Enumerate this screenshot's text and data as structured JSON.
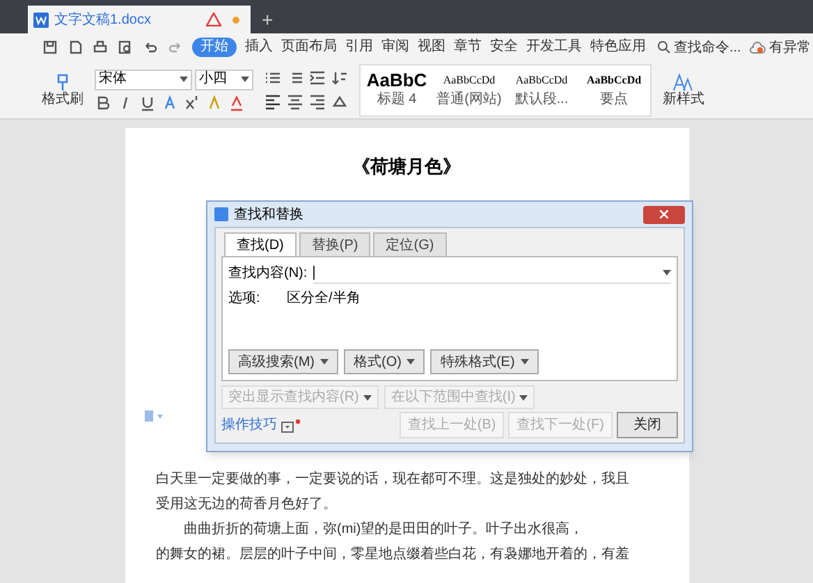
{
  "tabbar": {
    "documents": [
      {
        "title": "文字文稿1.docx",
        "selected": true,
        "warning": true,
        "unsaved": true
      }
    ],
    "new_tab": "+"
  },
  "menu": {
    "items": [
      {
        "label": "开始",
        "selected": true
      },
      {
        "label": "插入",
        "selected": false
      },
      {
        "label": "页面布局",
        "selected": false
      },
      {
        "label": "引用",
        "selected": false
      },
      {
        "label": "审阅",
        "selected": false
      },
      {
        "label": "视图",
        "selected": false
      },
      {
        "label": "章节",
        "selected": false
      },
      {
        "label": "安全",
        "selected": false
      },
      {
        "label": "开发工具",
        "selected": false
      },
      {
        "label": "特色应用",
        "selected": false
      }
    ],
    "search": "查找命令...",
    "status": "有异常"
  },
  "ribbon": {
    "format_painter": "格式刷",
    "font": "宋体",
    "size": "小四",
    "styles": [
      {
        "sample": "AaBbC",
        "label": "标题 4",
        "kind": "heading"
      },
      {
        "sample": "AaBbCcDd",
        "label": "普通(网站)",
        "kind": "normal"
      },
      {
        "sample": "AaBbCcDd",
        "label": "默认段...",
        "kind": "normal"
      },
      {
        "sample": "AaBbCcDd",
        "label": "要点",
        "kind": "bold"
      }
    ],
    "new_style": "新样式"
  },
  "document": {
    "title": "《荷塘月色》",
    "paragraphs_below": [
      "白天里一定要做的事，一定要说的话，现在都可不理。这是独处的妙处，我且",
      "受用这无边的荷香月色好了。",
      "　　曲曲折折的荷塘上面，弥(mi)望的是田田的叶子。叶子出水很高，",
      "的舞女的裙。层层的叶子中间，零星地点缀着些白花，有袅娜地开着的，有羞"
    ]
  },
  "dialog": {
    "title": "查找和替换",
    "tabs": [
      {
        "label": "查找(D)",
        "selected": true
      },
      {
        "label": "替换(P)",
        "selected": false
      },
      {
        "label": "定位(G)",
        "selected": false
      }
    ],
    "find_label": "查找内容(N):",
    "options_label": "选项:",
    "options_value": "区分全/半角",
    "option_buttons": [
      {
        "label": "高级搜索(M)",
        "disabled": false
      },
      {
        "label": "格式(O)",
        "disabled": false
      },
      {
        "label": "特殊格式(E)",
        "disabled": false
      }
    ],
    "scope_buttons": [
      {
        "label": "突出显示查找内容(R)",
        "disabled": true
      },
      {
        "label": "在以下范围中查找(I)",
        "disabled": true
      }
    ],
    "tips_link": "操作技巧",
    "actions": [
      {
        "label": "查找上一处(B)",
        "disabled": true
      },
      {
        "label": "查找下一处(F)",
        "disabled": true
      },
      {
        "label": "关闭",
        "disabled": false
      }
    ]
  }
}
